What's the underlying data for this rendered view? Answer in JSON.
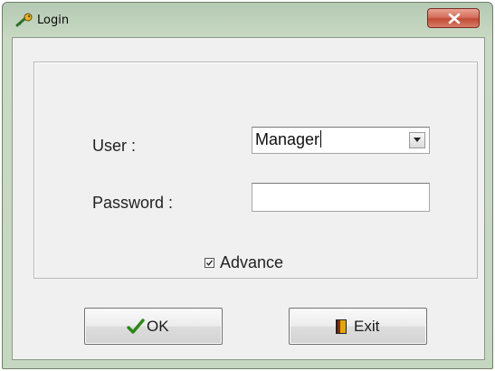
{
  "window": {
    "title": "Login",
    "title_icon": "key-icon",
    "close_icon": "close-icon"
  },
  "form": {
    "user_label": "User :",
    "user_value": "Manager",
    "user_dropdown_icon": "chevron-down-icon",
    "password_label": "Password :",
    "password_value": "",
    "advance_label": "Advance",
    "advance_checked": true
  },
  "buttons": {
    "ok_label": "OK",
    "ok_icon": "checkmark-icon",
    "exit_label": "Exit",
    "exit_icon": "door-icon"
  },
  "colors": {
    "ok_check": "#2a8a14",
    "close_button": "#c94f37",
    "door": "#e0a800"
  }
}
